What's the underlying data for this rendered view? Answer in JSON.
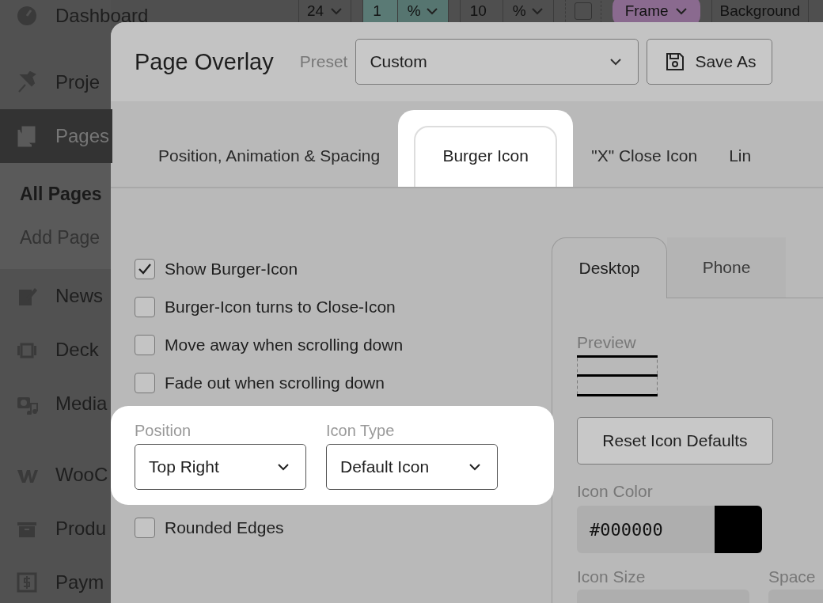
{
  "toolbar": {
    "items": [
      {
        "kind": "select",
        "value": "24"
      },
      {
        "kind": "unit",
        "value": "1",
        "unit": "%"
      },
      {
        "kind": "unit",
        "value": "10",
        "unit": "%"
      },
      {
        "kind": "check",
        "checked": false
      },
      {
        "kind": "pill",
        "value": "Frame"
      },
      {
        "kind": "plain",
        "value": "Background"
      }
    ]
  },
  "sidebar": {
    "items": [
      {
        "label": "Dashboard",
        "selected": false
      },
      {
        "label": "Proje",
        "selected": false
      },
      {
        "label": "Pages",
        "selected": true,
        "children": [
          {
            "label": "All Pages",
            "selected": true
          },
          {
            "label": "Add Page",
            "selected": false
          }
        ]
      },
      {
        "label": "News",
        "selected": false
      },
      {
        "label": "Deck",
        "selected": false
      },
      {
        "label": "Media",
        "selected": false
      },
      {
        "label": "WooC",
        "selected": false
      },
      {
        "label": "Produ",
        "selected": false
      },
      {
        "label": "Paym",
        "selected": false
      }
    ]
  },
  "dialog": {
    "title": "Page Overlay",
    "preset_label": "Preset",
    "preset": "Custom",
    "save_button": "Save As",
    "tabs": [
      {
        "label": "Position, Animation & Spacing",
        "selected": false
      },
      {
        "label": "Burger Icon",
        "selected": true
      },
      {
        "label": "\"X\" Close Icon",
        "selected": false
      },
      {
        "label": "Lin",
        "selected": false
      }
    ],
    "options": [
      {
        "kind": "checkbox",
        "label": "Show Burger-Icon",
        "checked": true
      },
      {
        "kind": "checkbox",
        "label": "Burger-Icon turns to Close-Icon",
        "checked": false
      },
      {
        "kind": "checkbox",
        "label": "Move away when scrolling down",
        "checked": false
      },
      {
        "kind": "checkbox",
        "label": "Fade out when scrolling down",
        "checked": false
      },
      {
        "kind": "selects",
        "fields": [
          {
            "label": "Position",
            "value": "Top Right"
          },
          {
            "label": "Icon Type",
            "value": "Default Icon"
          }
        ]
      },
      {
        "kind": "checkbox",
        "label": "Rounded Edges",
        "checked": false
      }
    ],
    "device_tabs": [
      {
        "label": "Desktop",
        "selected": true
      },
      {
        "label": "Phone",
        "selected": false
      }
    ],
    "preview_label": "Preview",
    "reset_button": "Reset Icon Defaults",
    "color_label": "Icon Color",
    "color_value": "#000000",
    "color": "#000000",
    "size_label": "Icon Size",
    "space_label": "Space"
  }
}
